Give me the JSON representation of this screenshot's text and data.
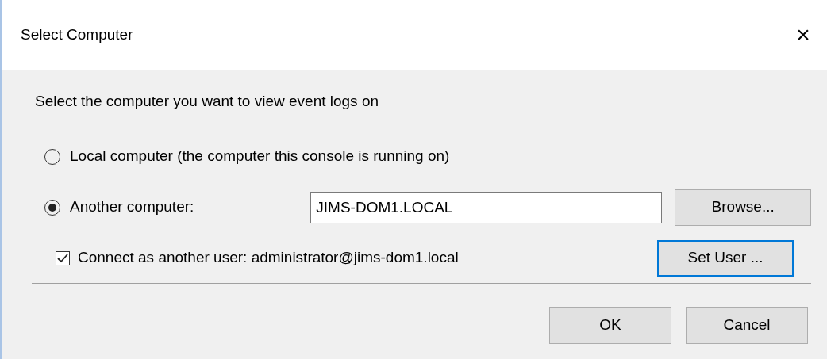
{
  "window": {
    "title": "Select Computer",
    "close": "×"
  },
  "prompt": "Select the computer you want to view event logs on",
  "options": [
    {
      "label": "Local computer (the computer this console is running on)",
      "selected": false
    },
    {
      "label": "Another computer:",
      "selected": true,
      "field_value": "JIMS-DOM1.LOCAL",
      "button": {
        "label": "Browse...",
        "focused": false
      }
    }
  ],
  "connect": {
    "label": "Connect as another user: administrator@jims-dom1.local",
    "checked": true,
    "button": {
      "label": "Set User ...",
      "focused": true
    }
  },
  "buttons": [
    {
      "label": "OK",
      "focused": false
    },
    {
      "label": "Cancel",
      "focused": false
    }
  ]
}
